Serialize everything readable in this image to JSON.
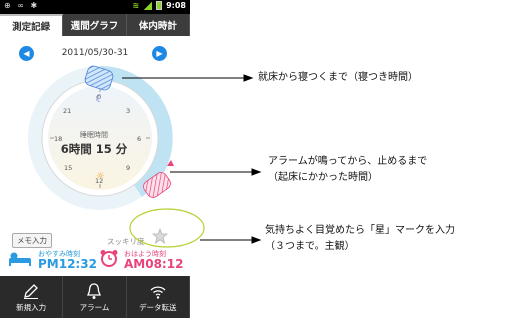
{
  "statusbar": {
    "left_icons": "⊕ ∞ ✱",
    "time": "9:08"
  },
  "tabs": [
    {
      "label": "測定記録",
      "active": true
    },
    {
      "label": "週間グラフ",
      "active": false
    },
    {
      "label": "体内時計",
      "active": false
    }
  ],
  "date_range": "2011/05/30-31",
  "clock_numbers": [
    "0",
    "3",
    "6",
    "9",
    "12",
    "15",
    "18",
    "21"
  ],
  "sleep": {
    "label": "睡眠時間",
    "value": "6時間 15 分"
  },
  "memo_label": "メモ入力",
  "bedtime": {
    "label": "おやすみ時刻",
    "time": "PM12:32"
  },
  "sukkiri_label": "スッキリ度",
  "waketime": {
    "label": "おはよう時刻",
    "time": "AM08:12"
  },
  "bottom_bar": [
    {
      "label": "新規入力",
      "icon": "pencil-icon"
    },
    {
      "label": "アラーム",
      "icon": "bell-icon"
    },
    {
      "label": "データ転送",
      "icon": "wireless-icon"
    }
  ],
  "annotations": {
    "a1": "就床から寝つくまで（寝つき時間）",
    "a2_line1": "アラームが鳴ってから、止めるまで",
    "a2_line2": "（起床にかかった時間）",
    "a3_line1": "気持ちよく目覚めたら「星」マークを入力",
    "a3_line2": "（３つまで。主観）"
  },
  "colors": {
    "accent_blue": "#1e88e5",
    "bedtime_blue": "#2a9be0",
    "waketime_pink": "#e8437b",
    "ring_blue": "#bfe3f3"
  }
}
